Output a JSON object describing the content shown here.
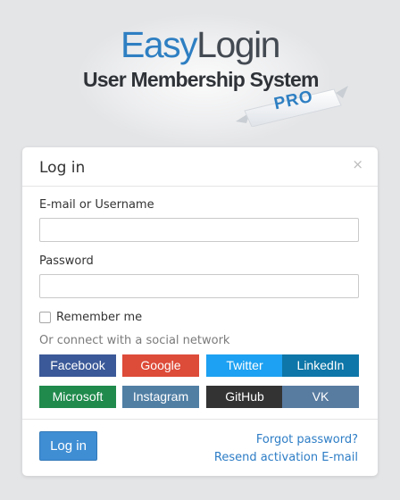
{
  "logo": {
    "title_part1": "Easy",
    "title_part2": "Login",
    "subtitle": "User Membership System",
    "badge": "PRO"
  },
  "modal": {
    "title": "Log in",
    "close_glyph": "×",
    "email_label": "E-mail or Username",
    "email_value": "",
    "password_label": "Password",
    "password_value": "",
    "remember_label": "Remember me",
    "remember_checked": false,
    "social_text": "Or connect with a social network",
    "social": [
      {
        "label": "Facebook",
        "color": "#3b5998"
      },
      {
        "label": "Google",
        "color": "#dd4b39"
      },
      {
        "label": "Twitter",
        "color": "#1da1f2"
      },
      {
        "label": "LinkedIn",
        "color": "#0e76a8"
      },
      {
        "label": "Microsoft",
        "color": "#1f8a4c"
      },
      {
        "label": "Instagram",
        "color": "#517fa4"
      },
      {
        "label": "GitHub",
        "color": "#333333"
      },
      {
        "label": "VK",
        "color": "#587ba0"
      }
    ],
    "login_button": "Log in",
    "forgot_link": "Forgot password?",
    "resend_link": "Resend activation E-mail"
  },
  "colors": {
    "background": "#e4e5e7",
    "brand_blue": "#2e7fc2",
    "primary_button": "#3f8ed4",
    "link": "#2d7dc6"
  }
}
